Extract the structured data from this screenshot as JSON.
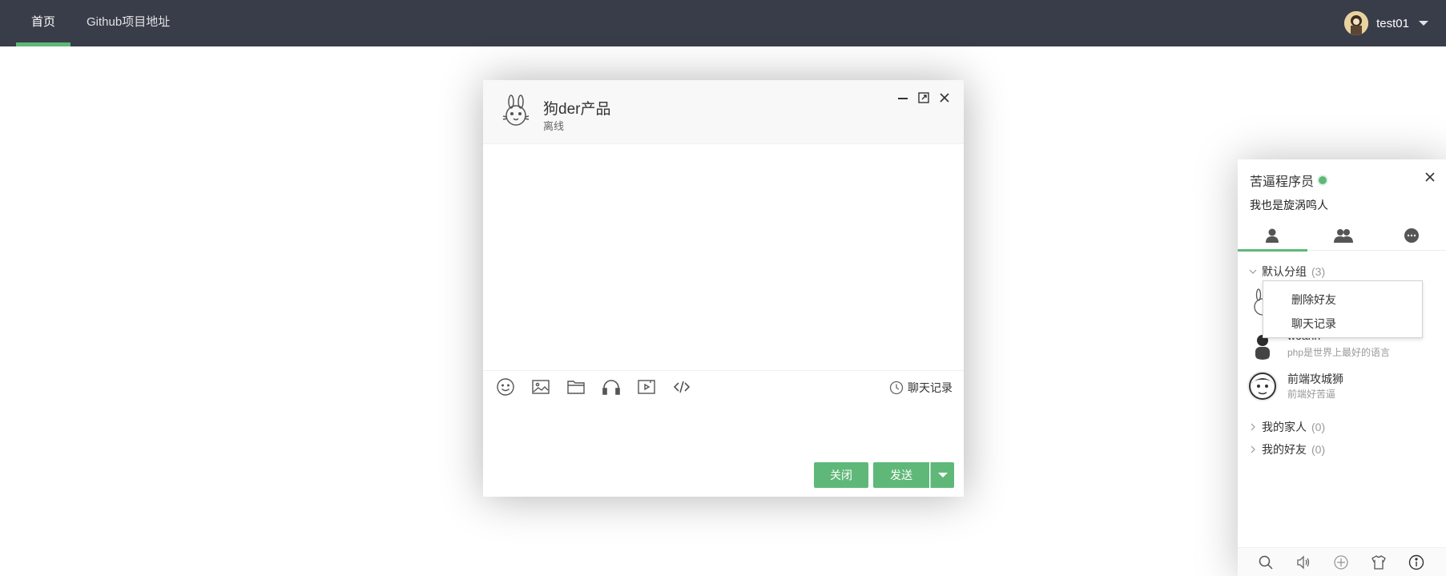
{
  "nav": {
    "items": [
      {
        "label": "首页",
        "active": true
      },
      {
        "label": "Github项目地址",
        "active": false
      }
    ],
    "user": {
      "name": "test01"
    }
  },
  "chat": {
    "contact_name": "狗der产品",
    "contact_status": "离线",
    "toolbar": {
      "icons": [
        "face-icon",
        "image-icon",
        "folder-icon",
        "headphones-icon",
        "video-icon",
        "code-icon"
      ],
      "history_label": "聊天记录"
    },
    "input": {
      "value": "",
      "placeholder": ""
    },
    "buttons": {
      "close": "关闭",
      "send": "发送"
    }
  },
  "panel": {
    "username": "苦逼程序员",
    "signature": "我也是旋涡鸣人",
    "tabs": [
      "friends-tab-icon",
      "groups-tab-icon",
      "messages-tab-icon"
    ],
    "groups": [
      {
        "name": "默认分组",
        "count": "(3)",
        "expanded": true,
        "friends": [
          {
            "name": "",
            "sign": ""
          },
          {
            "name": "woahh",
            "sign": "php是世界上最好的语言"
          },
          {
            "name": "前端攻城狮",
            "sign": "前端好苦逼"
          }
        ]
      },
      {
        "name": "我的家人",
        "count": "(0)",
        "expanded": false
      },
      {
        "name": "我的好友",
        "count": "(0)",
        "expanded": false
      }
    ],
    "context_menu": [
      "删除好友",
      "聊天记录"
    ],
    "bottom_icons": [
      "search-icon",
      "sound-icon",
      "add-icon",
      "skin-icon",
      "info-icon"
    ]
  },
  "colors": {
    "nav_bg": "#393d49",
    "accent": "#5fb878",
    "header_bg": "#f8f8f8"
  }
}
